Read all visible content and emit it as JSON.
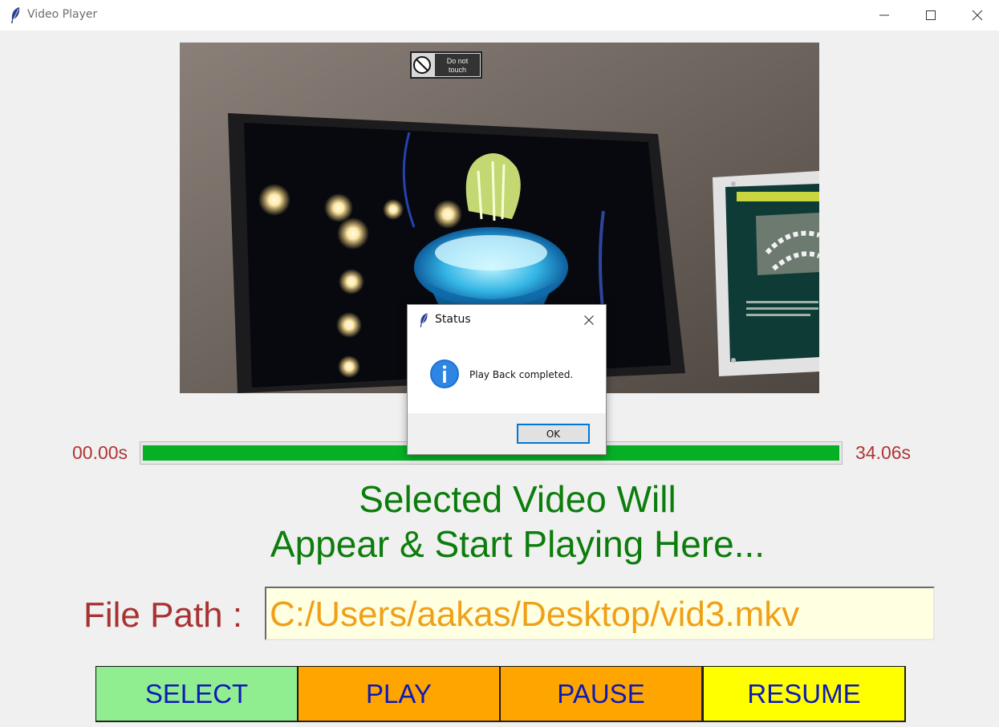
{
  "window": {
    "title": "Video Player",
    "icon": "feather-icon",
    "controls": [
      "minimize-icon",
      "maximize-icon",
      "close-icon"
    ]
  },
  "video": {
    "sign_text": "Do not touch"
  },
  "progress": {
    "start_time": "00.00s",
    "end_time": "34.06s",
    "fraction": 1.0,
    "fill_color": "#06b025"
  },
  "headline": {
    "line1": "Selected Video Will",
    "line2": "Appear & Start Playing Here..."
  },
  "file_path": {
    "label": "File Path :",
    "value": "C:/Users/aakas/Desktop/vid3.mkv"
  },
  "buttons": {
    "select": "SELECT",
    "play": "PLAY",
    "pause": "PAUSE",
    "resume": "RESUME"
  },
  "dialog": {
    "title": "Status",
    "message": "Play Back completed.",
    "ok_label": "OK",
    "icon": "info-icon"
  },
  "colors": {
    "select_bg": "#90ee90",
    "play_bg": "#ffa500",
    "pause_bg": "#ffa500",
    "resume_bg": "#ffff00",
    "button_text": "#0e1ab8",
    "headline_text": "#0c7d0c",
    "path_text": "#f0a018",
    "label_text": "#a83232"
  }
}
